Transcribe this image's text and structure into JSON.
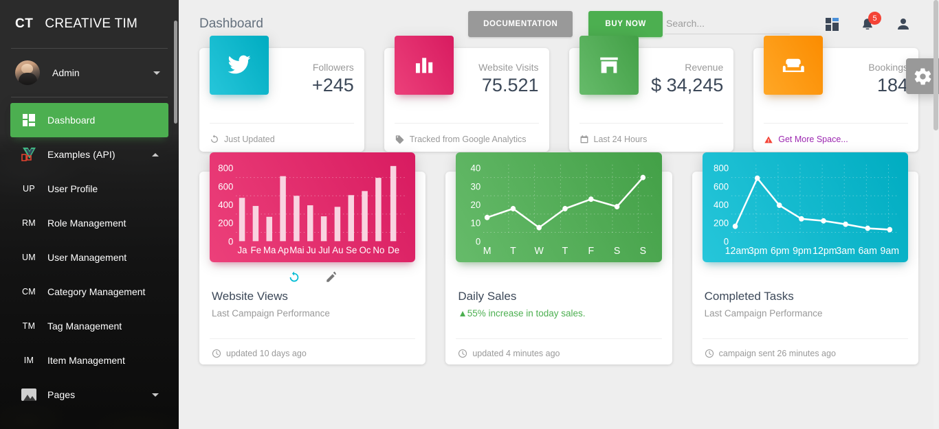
{
  "sidebar": {
    "brand_mark": "CT",
    "brand_name": "CREATIVE TIM",
    "user_name": "Admin",
    "nav": [
      {
        "label": "Dashboard",
        "icon": "dashboard-grid-icon",
        "active": true
      },
      {
        "label": "Examples (API)",
        "icon": "vue-laravel-logo-icon",
        "expanded": true
      },
      {
        "label": "Pages",
        "icon": "image-icon",
        "expanded": false
      }
    ],
    "sub_items": [
      {
        "abbr": "UP",
        "label": "User Profile"
      },
      {
        "abbr": "RM",
        "label": "Role Management"
      },
      {
        "abbr": "UM",
        "label": "User Management"
      },
      {
        "abbr": "CM",
        "label": "Category Management"
      },
      {
        "abbr": "TM",
        "label": "Tag Management"
      },
      {
        "abbr": "IM",
        "label": "Item Management"
      }
    ]
  },
  "topnav": {
    "page_title": "Dashboard",
    "documentation_label": "DOCUMENTATION",
    "buy_now_label": "BUY NOW",
    "search_placeholder": "Search...",
    "search_value": "",
    "notification_count": "5",
    "icons": [
      "apps-grid-icon",
      "notifications-bell-icon",
      "person-account-icon"
    ],
    "settings_icon": "gear-icon"
  },
  "stats": [
    {
      "icon": "twitter-bird-icon",
      "label": "Followers",
      "value": "+245",
      "footer": "Just Updated",
      "footer_icon": "refresh-icon",
      "color": "#00acc1"
    },
    {
      "icon": "bar-chart-icon",
      "label": "Website Visits",
      "value": "75.521",
      "footer": "Tracked from Google Analytics",
      "footer_icon": "tag-icon",
      "color": "#d81b60"
    },
    {
      "icon": "store-icon",
      "label": "Revenue",
      "value": "$ 34,245",
      "footer": "Last 24 Hours",
      "footer_icon": "calendar-icon",
      "color": "#43a047"
    },
    {
      "icon": "sofa-icon",
      "label": "Bookings",
      "value": "184",
      "footer": "Get More Space...",
      "footer_icon": "warning-icon",
      "color": "#fb8c00",
      "footer_is_link": true
    }
  ],
  "chart_cards": [
    {
      "title": "Website Views",
      "subtitle": "Last Campaign Performance",
      "footer": "updated 10 days ago",
      "footer_icon": "clock-icon",
      "color": "#d81b60",
      "actions": [
        "refresh-icon",
        "edit-pencil-icon"
      ]
    },
    {
      "title": "Daily Sales",
      "subtitle": "55% increase in today sales.",
      "subtitle_prefix": "▲",
      "footer": "updated 4 minutes ago",
      "footer_icon": "clock-icon",
      "color": "#43a047",
      "actions": []
    },
    {
      "title": "Completed Tasks",
      "subtitle": "Last Campaign Performance",
      "footer": "campaign sent 26 minutes ago",
      "footer_icon": "clock-icon",
      "color": "#00acc1",
      "actions": []
    }
  ],
  "chart_data": [
    {
      "type": "bar",
      "title": "Website Views",
      "categories": [
        "Ja",
        "Fe",
        "Ma",
        "Ap",
        "Mai",
        "Ju",
        "Jul",
        "Au",
        "Se",
        "Oc",
        "No",
        "De"
      ],
      "values": [
        480,
        390,
        270,
        720,
        500,
        400,
        275,
        380,
        510,
        555,
        700,
        830
      ],
      "yticks": [
        0,
        200,
        400,
        600,
        800
      ],
      "ylim": [
        0,
        880
      ],
      "xlabel": "",
      "ylabel": "",
      "grid": true,
      "bar_color": "#f8d4e0",
      "bg_color": "#d81b60"
    },
    {
      "type": "line",
      "title": "Daily Sales",
      "categories": [
        "M",
        "T",
        "W",
        "T",
        "F",
        "S",
        "S"
      ],
      "values": [
        9,
        14,
        4,
        14,
        20,
        15,
        35
      ],
      "yticks": [
        0,
        10,
        20,
        30,
        40
      ],
      "ylim": [
        0,
        44
      ],
      "xlabel": "",
      "ylabel": "",
      "grid": true,
      "line_color": "#ffffff",
      "bg_color": "#43a047"
    },
    {
      "type": "line",
      "title": "Completed Tasks",
      "categories": [
        "12am",
        "3pm",
        "6pm",
        "9pm",
        "12pm",
        "3am",
        "6am",
        "9am"
      ],
      "values": [
        165,
        685,
        390,
        245,
        225,
        185,
        140,
        130
      ],
      "yticks": [
        0,
        200,
        400,
        600,
        800
      ],
      "ylim": [
        0,
        880
      ],
      "xlabel": "",
      "ylabel": "",
      "grid": true,
      "line_color": "#ffffff",
      "bg_color": "#00acc1"
    }
  ]
}
